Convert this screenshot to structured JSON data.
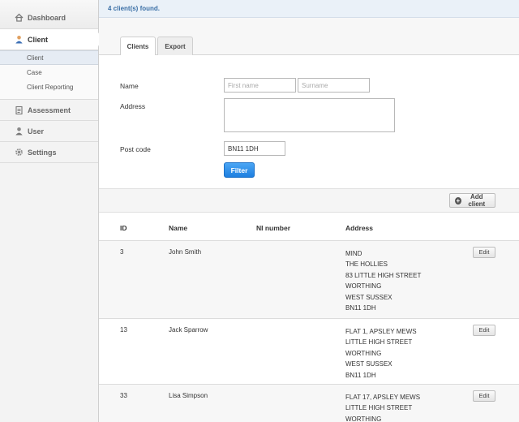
{
  "sidebar": {
    "items": [
      {
        "label": "Dashboard",
        "icon": "home-icon"
      },
      {
        "label": "Client",
        "icon": "user-icon"
      },
      {
        "label": "Assessment",
        "icon": "clipboard-icon"
      },
      {
        "label": "User",
        "icon": "user-icon"
      },
      {
        "label": "Settings",
        "icon": "gear-icon"
      }
    ],
    "client_subitems": [
      "Client",
      "Case",
      "Client Reporting"
    ]
  },
  "info": {
    "message": "4 client(s) found."
  },
  "tabs": [
    "Clients",
    "Export"
  ],
  "form": {
    "name_label": "Name",
    "first_name_placeholder": "First name",
    "surname_placeholder": "Surname",
    "address_label": "Address",
    "postcode_label": "Post code",
    "postcode_value": "BN11 1DH",
    "filter_label": "Filter"
  },
  "actions": {
    "add_client_label": "Add client"
  },
  "table": {
    "headers": [
      "ID",
      "Name",
      "NI number",
      "Address"
    ],
    "edit_label": "Edit",
    "rows": [
      {
        "id": "3",
        "name": "John Smith",
        "ni": "",
        "address": [
          "MIND",
          "THE HOLLIES",
          "83 LITTLE HIGH STREET",
          "WORTHING",
          "WEST SUSSEX",
          "BN11 1DH"
        ]
      },
      {
        "id": "13",
        "name": "Jack Sparrow",
        "ni": "",
        "address": [
          "FLAT 1, APSLEY MEWS",
          "LITTLE HIGH STREET",
          "WORTHING",
          "WEST SUSSEX",
          "BN11 1DH"
        ]
      },
      {
        "id": "33",
        "name": "Lisa Simpson",
        "ni": "",
        "address": [
          "FLAT 17, APSLEY MEWS",
          "LITTLE HIGH STREET",
          "WORTHING"
        ]
      }
    ]
  },
  "colors": {
    "accent": "#1e7fe0",
    "info_text": "#3a6fa6"
  }
}
